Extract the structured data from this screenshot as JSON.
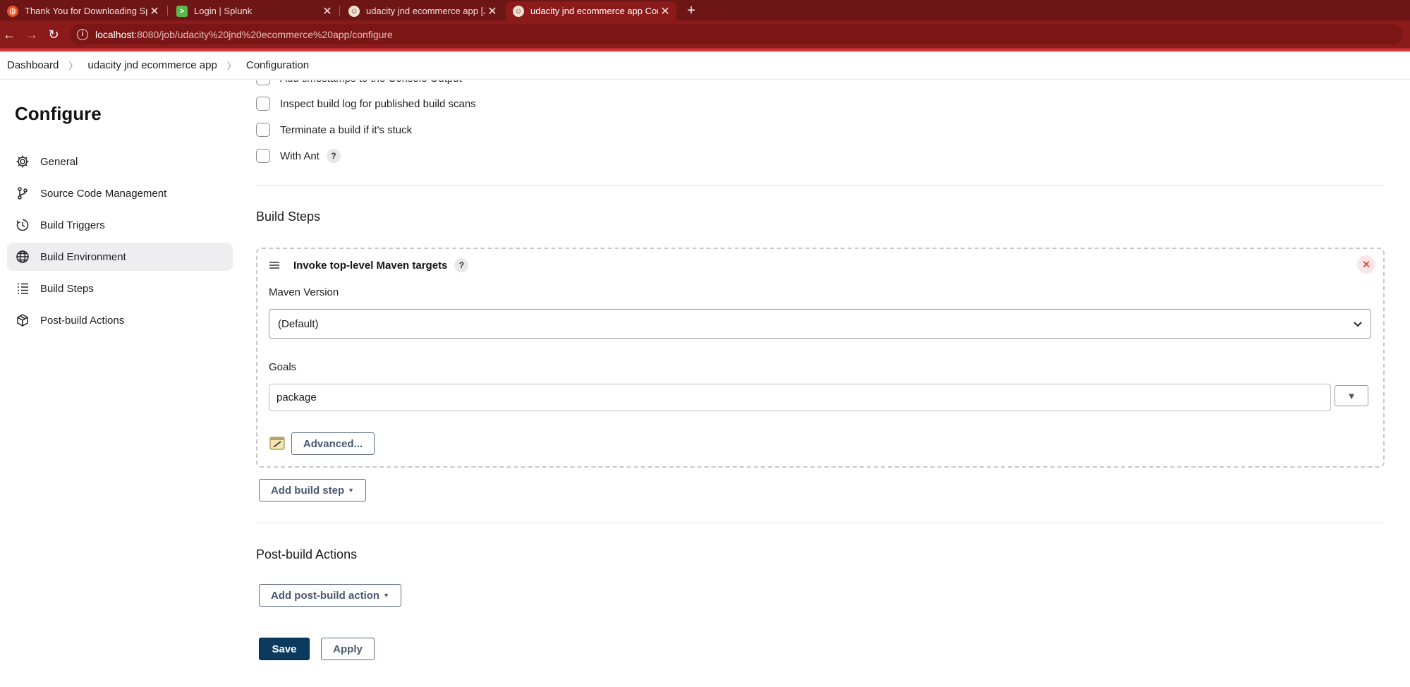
{
  "browser": {
    "tabs": [
      {
        "label": "Thank You for Downloading Splu",
        "favicon": "splunk-orange-icon"
      },
      {
        "label": "Login | Splunk",
        "favicon": "splunk-green-icon"
      },
      {
        "label": "udacity jnd ecommerce app [Jenl",
        "favicon": "jenkins-icon"
      },
      {
        "label": "udacity jnd ecommerce app Conf",
        "favicon": "jenkins-icon",
        "active": true
      }
    ],
    "url_host": "localhost",
    "url_path": ":8080/job/udacity%20jnd%20ecommerce%20app/configure",
    "theme_color": "#8b1a1a"
  },
  "breadcrumb": {
    "items": [
      "Dashboard",
      "udacity jnd ecommerce app",
      "Configuration"
    ]
  },
  "sidebar": {
    "title": "Configure",
    "items": [
      {
        "label": "General",
        "icon": "gear-icon"
      },
      {
        "label": "Source Code Management",
        "icon": "branch-icon"
      },
      {
        "label": "Build Triggers",
        "icon": "clock-icon"
      },
      {
        "label": "Build Environment",
        "icon": "globe-icon",
        "active": true
      },
      {
        "label": "Build Steps",
        "icon": "list-icon"
      },
      {
        "label": "Post-build Actions",
        "icon": "package-icon"
      }
    ]
  },
  "build_env": {
    "options": [
      {
        "label": "Add timestamps to the Console Output",
        "checked": false
      },
      {
        "label": "Inspect build log for published build scans",
        "checked": false
      },
      {
        "label": "Terminate a build if it's stuck",
        "checked": false
      },
      {
        "label": "With Ant",
        "checked": false,
        "help": "?"
      }
    ]
  },
  "build_steps": {
    "title": "Build Steps",
    "step": {
      "title": "Invoke top-level Maven targets",
      "help": "?",
      "maven_version_label": "Maven Version",
      "maven_version_value": "(Default)",
      "goals_label": "Goals",
      "goals_value": "package",
      "advanced_label": "Advanced..."
    },
    "add_label": "Add build step"
  },
  "post_build": {
    "title": "Post-build Actions",
    "add_label": "Add post-build action"
  },
  "actions": {
    "save_label": "Save",
    "apply_label": "Apply"
  }
}
